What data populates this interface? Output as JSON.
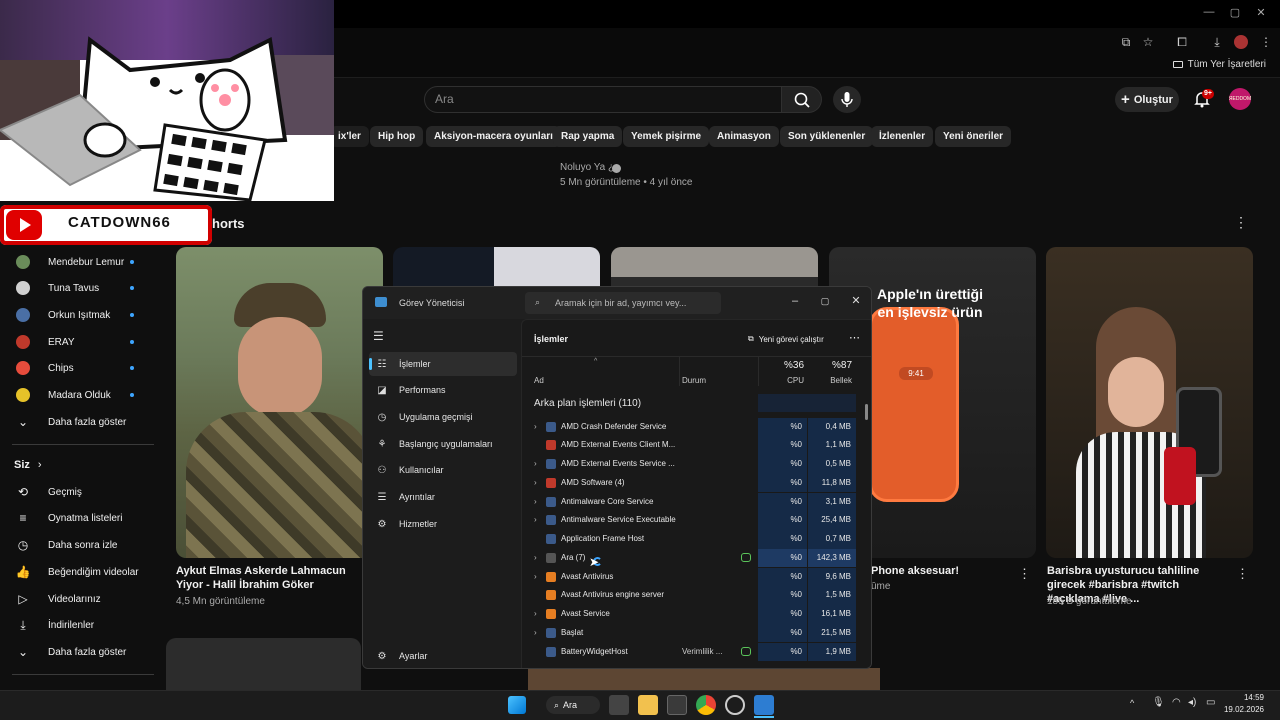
{
  "browser": {
    "bookmark_folder": "Tüm Yer İşaretleri"
  },
  "youtube": {
    "search_placeholder": "Ara",
    "create_label": "Oluştur",
    "notif_count": "9+",
    "avatar_text": "ЯEDDOM",
    "chips": [
      "ix'ler",
      "Hip hop",
      "Aksiyon-macera oyunları",
      "Rap yapma",
      "Yemek pişirme",
      "Animasyon",
      "Son yüklenenler",
      "İzlenenler",
      "Yeni öneriler"
    ],
    "top_video": {
      "channel": "Noluyo Ya ¿",
      "meta": "5 Mn görüntüleme • 4 yıl önce"
    },
    "shorts_label": "horts",
    "sidebar_subs": [
      {
        "name": "Mendebur Lemur",
        "color": "#6a8c5a"
      },
      {
        "name": "Tuna Tavus",
        "color": "#d0d0d0"
      },
      {
        "name": "Orkun Işıtmak",
        "color": "#4a6fa5"
      },
      {
        "name": "ERAY",
        "color": "#c0392b"
      },
      {
        "name": "Chips",
        "color": "#e74c3c"
      },
      {
        "name": "Madara Olduk",
        "color": "#e6c229"
      }
    ],
    "sidebar_more": "Daha fazla göster",
    "you_section": "Siz",
    "you_items": [
      {
        "label": "Geçmiş",
        "icon": "⟲"
      },
      {
        "label": "Oynatma listeleri",
        "icon": "≡"
      },
      {
        "label": "Daha sonra izle",
        "icon": "◷"
      },
      {
        "label": "Beğendiğim videolar",
        "icon": "👍"
      },
      {
        "label": "Videolarınız",
        "icon": "▷"
      },
      {
        "label": "İndirilenler",
        "icon": "⤓"
      },
      {
        "label": "Daha fazla göster",
        "icon": "⌄"
      }
    ],
    "videos": [
      {
        "title": "Aykut Elmas Askerde Lahmacun Yiyor - Halil İbrahim Göker",
        "meta": "4,5 Mn görüntüleme"
      },
      {
        "title": "Phone aksesuar!",
        "meta": "ūme",
        "thumb_caption": "Apple'ın ürettiği en işlevsiz ürün"
      },
      {
        "title": "Barisbra uyusturucu tahliline girecek #barisbra #twitch #açıklama #live ...",
        "meta": "185 B görüntüleme"
      }
    ]
  },
  "overlay": {
    "channel_name": "CATDOWN66"
  },
  "task_manager": {
    "title": "Görev Yöneticisi",
    "search_placeholder": "Aramak için bir ad, yayımcı vey...",
    "nav": [
      {
        "label": "İşlemler",
        "icon": "☷",
        "active": true
      },
      {
        "label": "Performans",
        "icon": "◪"
      },
      {
        "label": "Uygulama geçmişi",
        "icon": "◷"
      },
      {
        "label": "Başlangıç uygulamaları",
        "icon": "⚘"
      },
      {
        "label": "Kullanıcılar",
        "icon": "⚇"
      },
      {
        "label": "Ayrıntılar",
        "icon": "☰"
      },
      {
        "label": "Hizmetler",
        "icon": "⚙"
      }
    ],
    "settings_label": "Ayarlar",
    "page_title": "İşlemler",
    "new_task": "Yeni görevi çalıştır",
    "col_name": "Ad",
    "col_status": "Durum",
    "cpu_total": "%36",
    "cpu_label": "CPU",
    "mem_total": "%87",
    "mem_label": "Bellek",
    "group_label": "Arka plan işlemleri (110)",
    "rows": [
      {
        "name": "AMD Crash Defender Service",
        "expand": true,
        "status": "",
        "leaf": false,
        "cpu": "%0",
        "mem": "0,4 MB",
        "color": "#3b5a8a"
      },
      {
        "name": "AMD External Events Client M...",
        "expand": false,
        "status": "",
        "leaf": false,
        "cpu": "%0",
        "mem": "1,1 MB",
        "color": "#c0392b"
      },
      {
        "name": "AMD External Events Service ...",
        "expand": true,
        "status": "",
        "leaf": false,
        "cpu": "%0",
        "mem": "0,5 MB",
        "color": "#3b5a8a"
      },
      {
        "name": "AMD Software (4)",
        "expand": true,
        "status": "",
        "leaf": false,
        "cpu": "%0",
        "mem": "11,8 MB",
        "color": "#c0392b"
      },
      {
        "name": "Antimalware Core Service",
        "expand": true,
        "status": "",
        "leaf": false,
        "cpu": "%0",
        "mem": "3,1 MB",
        "color": "#3b5a8a"
      },
      {
        "name": "Antimalware Service Executable",
        "expand": true,
        "status": "",
        "leaf": false,
        "cpu": "%0",
        "mem": "25,4 MB",
        "color": "#3b5a8a"
      },
      {
        "name": "Application Frame Host",
        "expand": false,
        "status": "",
        "leaf": false,
        "cpu": "%0",
        "mem": "0,7 MB",
        "color": "#3b5a8a"
      },
      {
        "name": "Ara (7)",
        "expand": true,
        "status": "",
        "leaf": true,
        "cpu": "%0",
        "mem": "142,3 MB",
        "color": "#555555"
      },
      {
        "name": "Avast Antivirus",
        "expand": true,
        "status": "",
        "leaf": false,
        "cpu": "%0",
        "mem": "9,6 MB",
        "color": "#e67e22"
      },
      {
        "name": "Avast Antivirus engine server",
        "expand": false,
        "status": "",
        "leaf": false,
        "cpu": "%0",
        "mem": "1,5 MB",
        "color": "#e67e22"
      },
      {
        "name": "Avast Service",
        "expand": true,
        "status": "",
        "leaf": false,
        "cpu": "%0",
        "mem": "16,1 MB",
        "color": "#e67e22"
      },
      {
        "name": "Başlat",
        "expand": true,
        "status": "",
        "leaf": false,
        "cpu": "%0",
        "mem": "21,5 MB",
        "color": "#3b5a8a"
      },
      {
        "name": "BatteryWidgetHost",
        "expand": false,
        "status": "Verimlilik ...",
        "leaf": true,
        "cpu": "%0",
        "mem": "1,9 MB",
        "color": "#3b5a8a"
      }
    ]
  },
  "taskbar": {
    "search_label": "Ara",
    "time": "14:59",
    "date": "19.02.2026"
  }
}
